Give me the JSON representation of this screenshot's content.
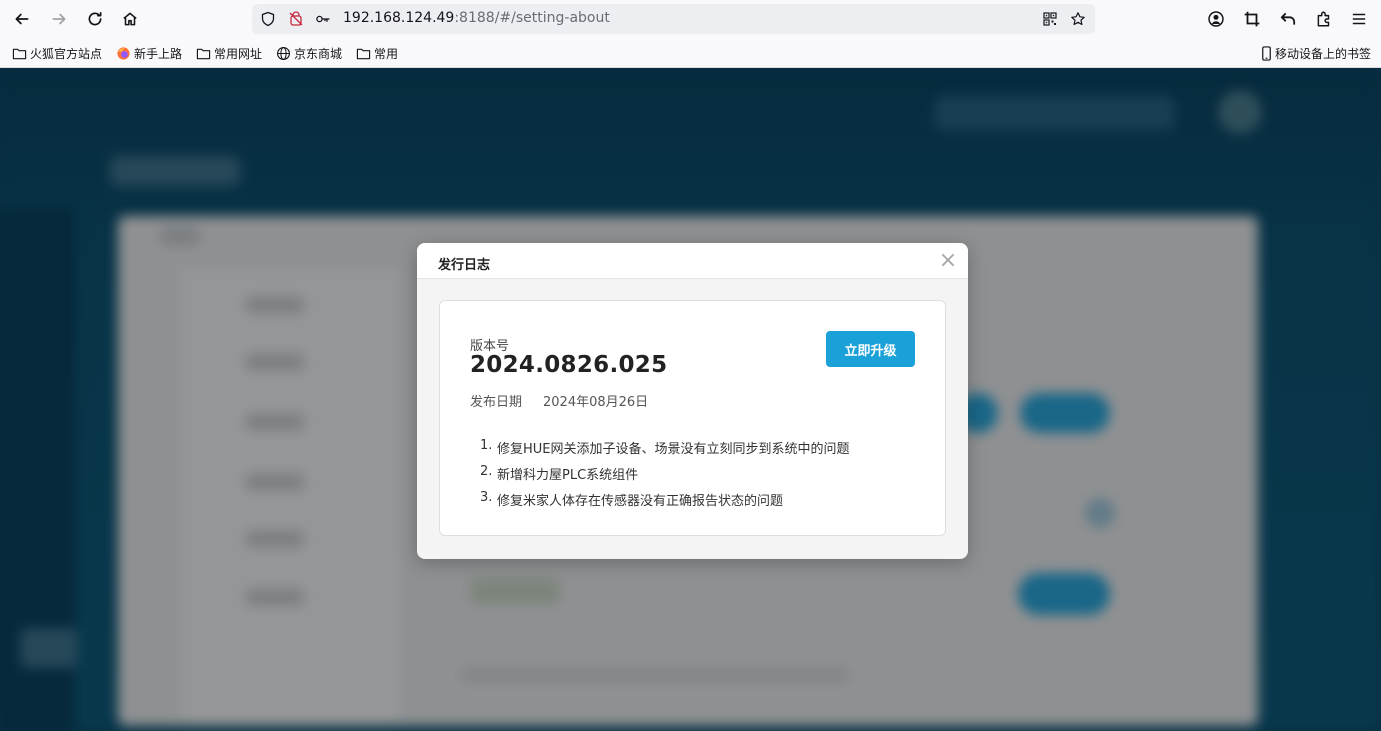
{
  "browser": {
    "url_host": "192.168.124.49",
    "url_path": ":8188/#/setting-about",
    "icons": {
      "back": "back-arrow-icon",
      "forward": "forward-arrow-icon",
      "reload": "reload-icon",
      "home": "home-icon",
      "shield": "shield-icon",
      "no-camera": "permission-blocked-icon",
      "key": "key-icon",
      "qr": "qr-code-icon",
      "star": "bookmark-star-icon",
      "account": "account-icon",
      "screenshot": "crop-icon",
      "undo": "undo-icon",
      "extensions": "extensions-icon",
      "menu": "menu-icon"
    }
  },
  "bookmarks": {
    "items": [
      {
        "label": "火狐官方站点",
        "icon": "folder-icon"
      },
      {
        "label": "新手上路",
        "icon": "firefox-icon"
      },
      {
        "label": "常用网址",
        "icon": "folder-icon"
      },
      {
        "label": "京东商城",
        "icon": "globe-icon"
      },
      {
        "label": "常用",
        "icon": "folder-icon"
      }
    ],
    "mobile": {
      "label": "移动设备上的书签",
      "icon": "mobile-icon"
    }
  },
  "modal": {
    "title": "发行日志",
    "close_symbol": "×",
    "version_label": "版本号",
    "version_value": "2024.0826.025",
    "upgrade_label": "立即升级",
    "date_label": "发布日期",
    "date_value": "2024年08月26日",
    "notes": [
      {
        "num": "1.",
        "text": "修复HUE网关添加子设备、场景没有立刻同步到系统中的问题"
      },
      {
        "num": "2.",
        "text": "新增科力屋PLC系统组件"
      },
      {
        "num": "3.",
        "text": "修复米家人体存在传感器没有正确报告状态的问题"
      }
    ]
  },
  "colors": {
    "accent": "#1aa1d8",
    "app_bg": "#0e5a7b"
  }
}
